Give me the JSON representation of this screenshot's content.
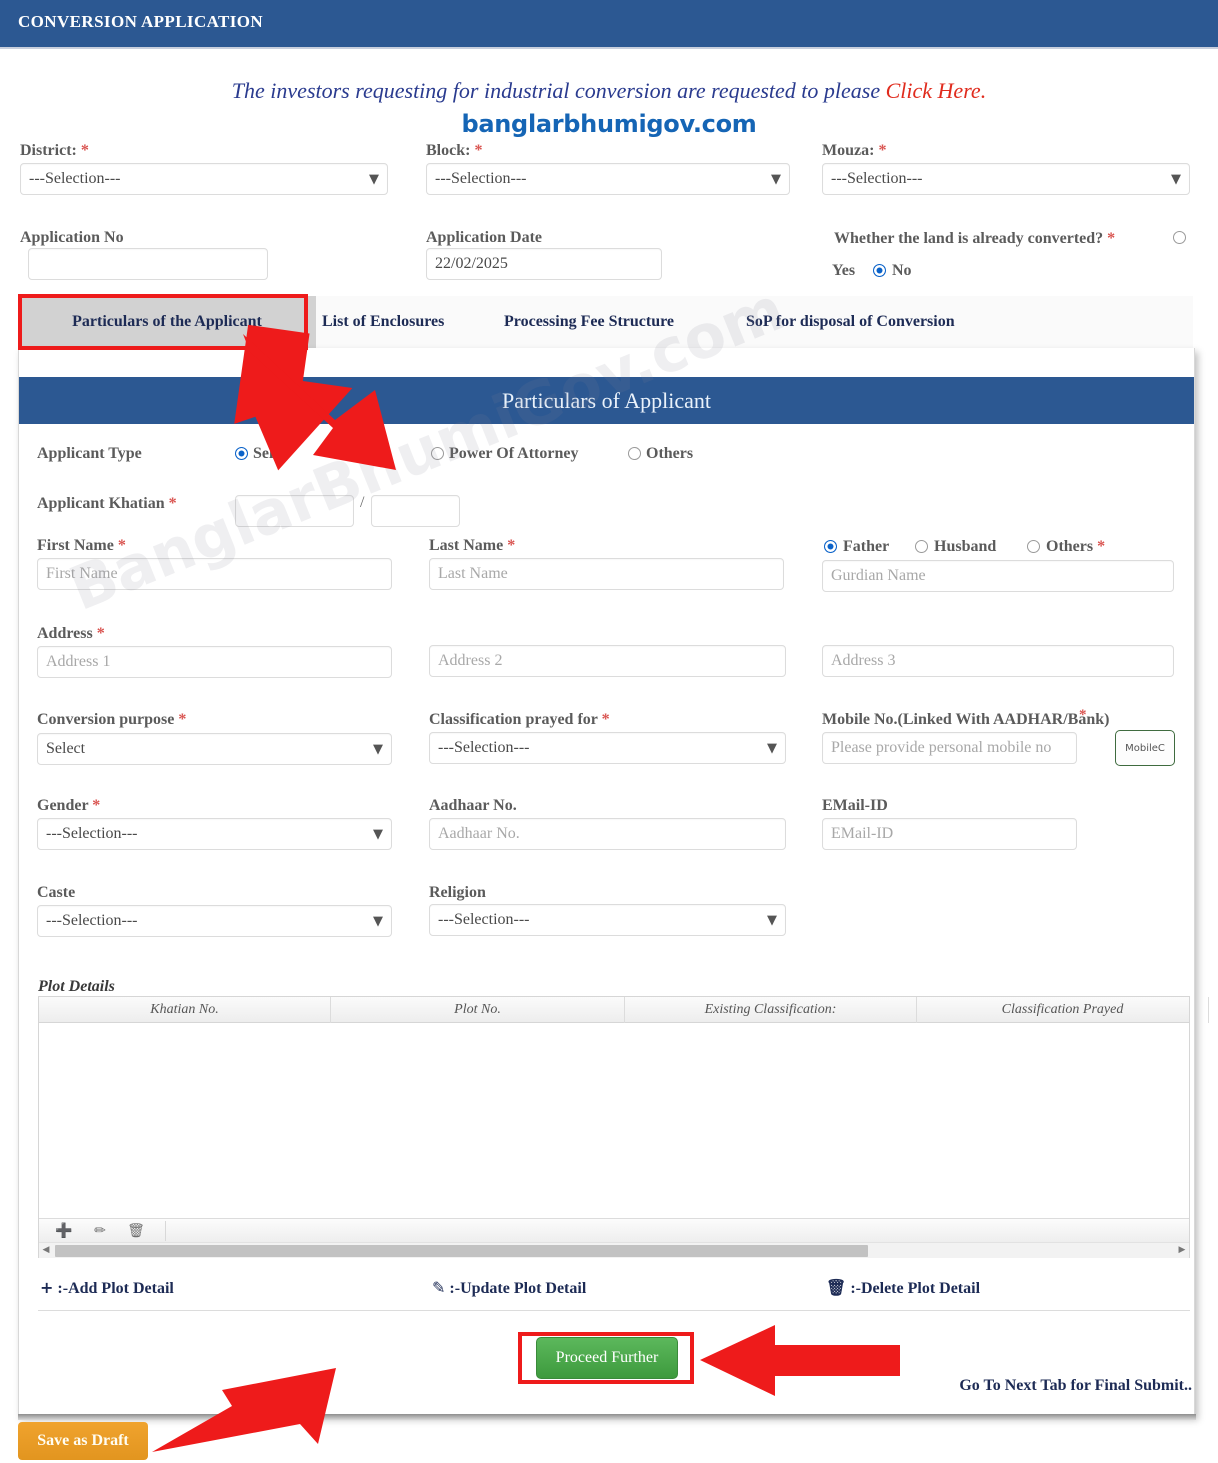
{
  "header": {
    "title": "CONVERSION APPLICATION"
  },
  "notice": {
    "text": "The investors requesting for industrial conversion are requested to please ",
    "link": "Click Here.",
    "sitename": "banglarbhumigov.com"
  },
  "top_form": {
    "district": {
      "label": "District:",
      "required": "*",
      "value": "---Selection---"
    },
    "block": {
      "label": "Block:",
      "required": "*",
      "value": "---Selection---"
    },
    "mouza": {
      "label": "Mouza:",
      "required": "*",
      "value": "---Selection---"
    },
    "application_no": {
      "label": "Application No",
      "value": ""
    },
    "application_date": {
      "label": "Application Date",
      "value": "22/02/2025"
    },
    "converted": {
      "label": "Whether the land is already converted?",
      "required": "*",
      "yes": "Yes",
      "no": "No",
      "selected": "No"
    }
  },
  "tabs": [
    {
      "label": "Particulars of the Applicant",
      "active": true
    },
    {
      "label": "List of Enclosures",
      "active": false
    },
    {
      "label": "Processing Fee Structure",
      "active": false
    },
    {
      "label": "SoP for disposal of Conversion",
      "active": false
    }
  ],
  "panel": {
    "band_title": "Particulars of Applicant",
    "applicant_type": {
      "label": "Applicant Type",
      "options": [
        "Self",
        "Power Of Attorney",
        "Others"
      ],
      "selected": "Self"
    },
    "applicant_khatian": {
      "label": "Applicant Khatian",
      "required": "*",
      "value1": "",
      "value2": "",
      "separator": "/"
    },
    "first_name": {
      "label": "First Name",
      "required": "*",
      "placeholder": "First Name",
      "value": ""
    },
    "last_name": {
      "label": "Last Name",
      "required": "*",
      "placeholder": "Last Name",
      "value": ""
    },
    "guardian": {
      "options": [
        "Father",
        "Husband",
        "Others"
      ],
      "selected": "Father",
      "required": "*",
      "placeholder": "Gurdian Name",
      "value": ""
    },
    "address": {
      "label": "Address",
      "required": "*",
      "placeholder1": "Address 1",
      "placeholder2": "Address 2",
      "placeholder3": "Address 3",
      "value1": "",
      "value2": "",
      "value3": ""
    },
    "conversion_purpose": {
      "label": "Conversion purpose",
      "required": "*",
      "value": "Select"
    },
    "classification_prayed_for": {
      "label": "Classification prayed for",
      "required": "*",
      "value": "---Selection---"
    },
    "mobile": {
      "label": "Mobile No.(Linked With AADHAR/Bank)",
      "required": "*",
      "placeholder": "Please provide personal mobile no",
      "value": "",
      "check_button": "MobileC"
    },
    "gender": {
      "label": "Gender",
      "required": "*",
      "value": "---Selection---"
    },
    "aadhaar": {
      "label": "Aadhaar No.",
      "placeholder": "Aadhaar No.",
      "value": ""
    },
    "email": {
      "label": "EMail-ID",
      "placeholder": "EMail-ID",
      "value": ""
    },
    "caste": {
      "label": "Caste",
      "value": "---Selection---"
    },
    "religion": {
      "label": "Religion",
      "value": "---Selection---"
    }
  },
  "plot_details": {
    "caption": "Plot Details",
    "columns": [
      "Khatian No.",
      "Plot No.",
      "Existing Classification:",
      "Classification Prayed"
    ],
    "rows": [],
    "toolbar_icons": [
      "add-icon",
      "edit-icon",
      "delete-icon"
    ],
    "legend": [
      {
        "icon": "+",
        "text": ":-Add Plot Detail"
      },
      {
        "icon": "✎",
        "text": ":-Update Plot Detail"
      },
      {
        "icon": "🗑",
        "text": ":-Delete Plot Detail"
      }
    ]
  },
  "footer": {
    "proceed": "Proceed Further",
    "next_tab_note": "Go To Next Tab for Final Submit..",
    "save_draft": "Save as Draft"
  },
  "watermark": "BanglarBhumiGov.com",
  "colors": {
    "header_blue": "#2c5892",
    "accent_red": "#e02b1d",
    "link_blue": "#1565b5",
    "proceed_green": "#3d9a3d",
    "draft_orange": "#e2951f",
    "annotation_red": "#ee1b1b"
  }
}
